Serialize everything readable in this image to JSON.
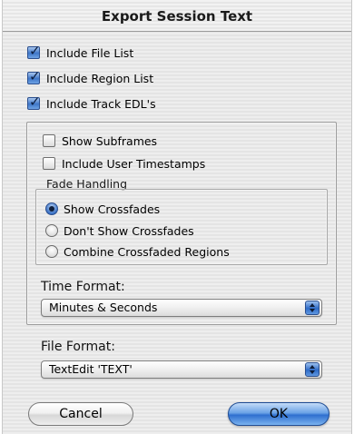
{
  "dialog": {
    "title": "Export Session Text"
  },
  "options": {
    "include_file_list": {
      "label": "Include File List",
      "checked": true
    },
    "include_region_list": {
      "label": "Include Region List",
      "checked": true
    },
    "include_track_edls": {
      "label": "Include Track EDL's",
      "checked": true
    },
    "show_subframes": {
      "label": "Show Subframes",
      "checked": false
    },
    "include_user_timestamps": {
      "label": "Include User Timestamps",
      "checked": false
    }
  },
  "fade_handling": {
    "label": "Fade Handling",
    "options": [
      {
        "label": "Show Crossfades",
        "selected": true
      },
      {
        "label": "Don't Show Crossfades",
        "selected": false
      },
      {
        "label": "Combine Crossfaded Regions",
        "selected": false
      }
    ]
  },
  "time_format": {
    "label": "Time Format:",
    "value": "Minutes & Seconds"
  },
  "file_format": {
    "label": "File Format:",
    "value": "TextEdit 'TEXT'"
  },
  "buttons": {
    "cancel": "Cancel",
    "ok": "OK"
  },
  "colors": {
    "accent_blue": "#3e76c8",
    "window_bg": "#ececec"
  }
}
